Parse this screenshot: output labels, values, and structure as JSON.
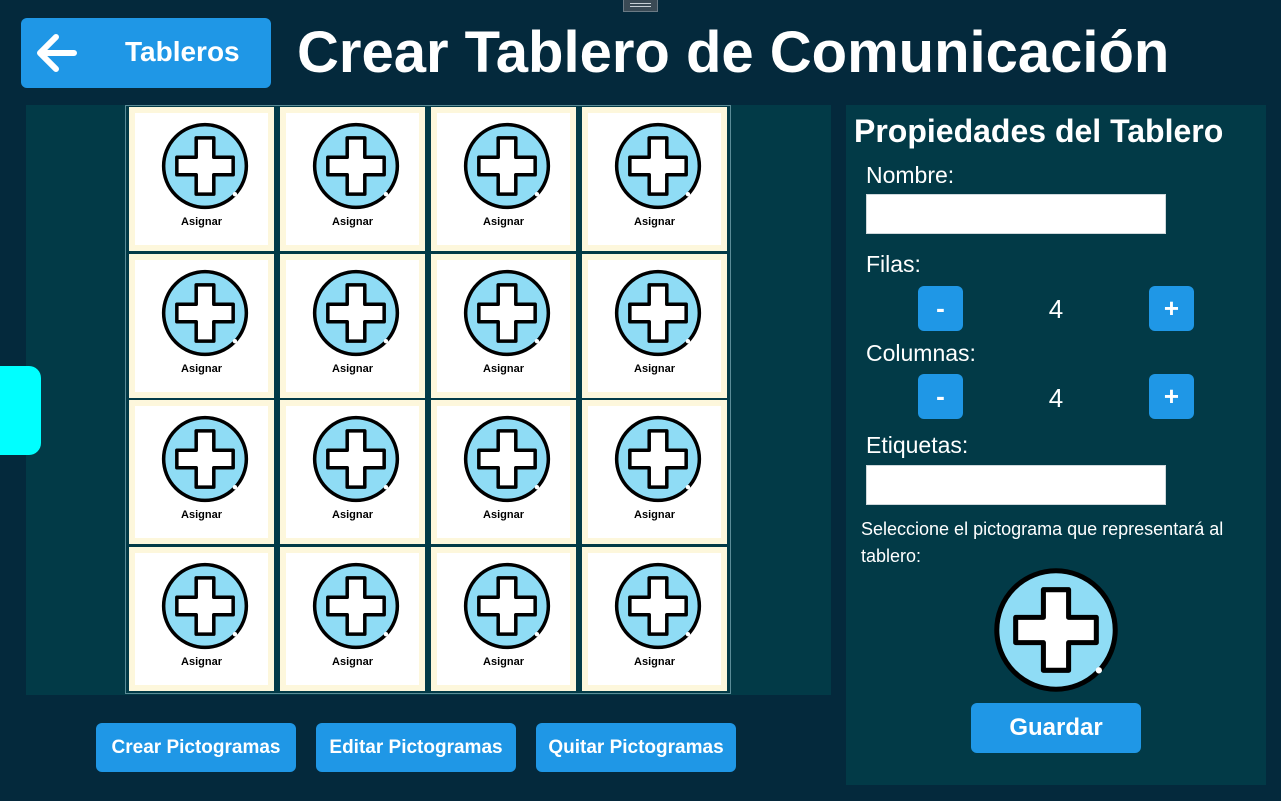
{
  "header": {
    "back_label": "Tableros",
    "title": "Crear Tablero de Comunicación"
  },
  "grid": {
    "rows": 4,
    "columns": 4,
    "cell_label": "Asignar",
    "cell_icon": "add-pictogram-icon"
  },
  "actions": {
    "create": "Crear Pictogramas",
    "edit": "Editar Pictogramas",
    "remove": "Quitar Pictogramas"
  },
  "properties": {
    "title": "Propiedades del Tablero",
    "name_label": "Nombre:",
    "name_value": "",
    "rows_label": "Filas:",
    "rows_value": "4",
    "columns_label": "Columnas:",
    "columns_value": "4",
    "decrement": "-",
    "increment": "+",
    "tags_label": "Etiquetas:",
    "tags_value": "",
    "pictogram_hint": "Seleccione el pictograma que representará al tablero:",
    "save_label": "Guardar"
  },
  "colors": {
    "background": "#04293c",
    "panel": "#023a47",
    "accent": "#1f97e6",
    "side_tab": "#00ffff",
    "icon_fill": "#8fdcf5"
  }
}
